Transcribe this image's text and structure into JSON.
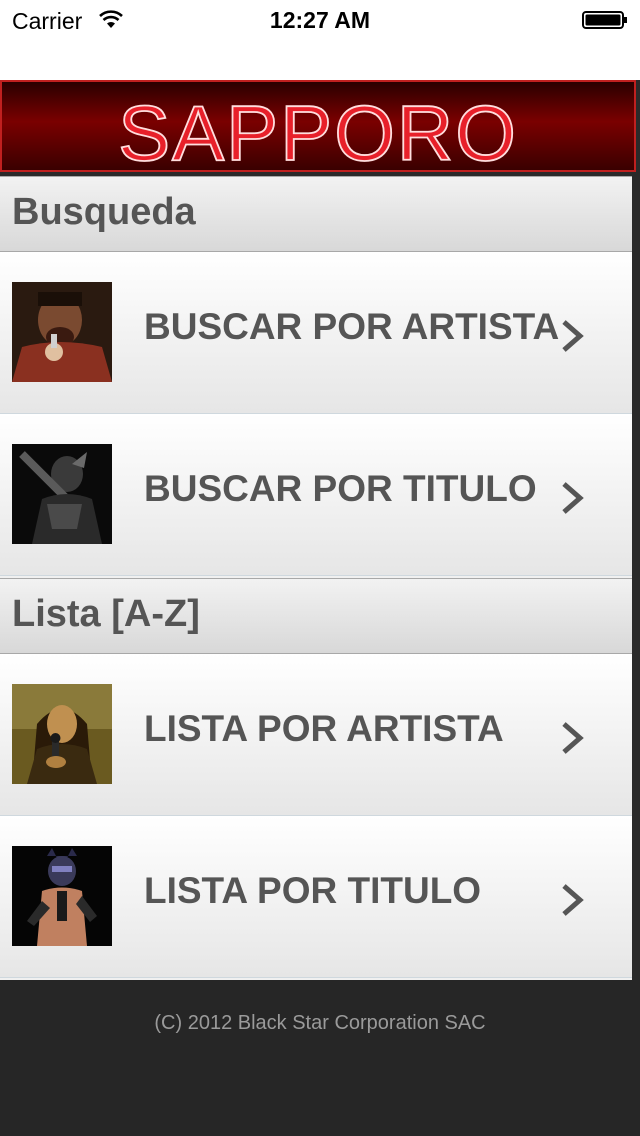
{
  "status_bar": {
    "carrier": "Carrier",
    "time": "12:27 AM"
  },
  "banner": {
    "title": "SAPPORO"
  },
  "sections": [
    {
      "header": "Busqueda",
      "rows": [
        {
          "label": "BUSCAR POR ARTISTA",
          "thumbnail": "spartan-warrior-singing"
        },
        {
          "label": "BUSCAR POR TITULO",
          "thumbnail": "dark-knight-figure"
        }
      ]
    },
    {
      "header": "Lista [A-Z]",
      "rows": [
        {
          "label": "LISTA POR ARTISTA",
          "thumbnail": "mona-lisa-with-microphone"
        },
        {
          "label": "LISTA POR TITULO",
          "thumbnail": "catwoman-with-microphone"
        }
      ]
    }
  ],
  "footer": {
    "copyright": "(C) 2012 Black Star Corporation SAC"
  },
  "colors": {
    "banner_red": "#c0201f",
    "label_gray": "#555555",
    "footer_bg": "#262626"
  }
}
